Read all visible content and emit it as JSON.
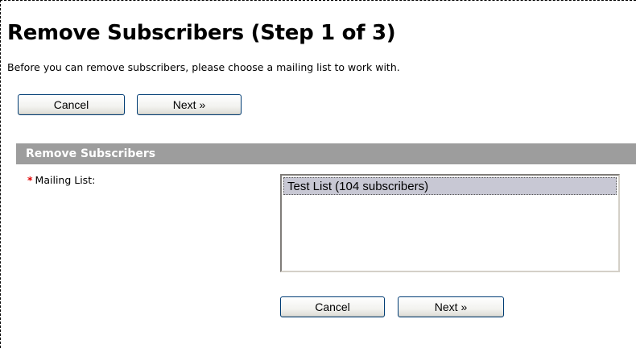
{
  "page": {
    "title": "Remove Subscribers (Step 1 of 3)",
    "intro": "Before you can remove subscribers, please choose a mailing list to work with."
  },
  "top_buttons": {
    "cancel": "Cancel",
    "next": "Next »"
  },
  "panel": {
    "header": "Remove Subscribers",
    "required_marker": "*",
    "mailing_list_label": "Mailing List:",
    "mailing_list_options": [
      {
        "label": "Test List (104 subscribers)",
        "selected": true
      }
    ]
  },
  "bottom_buttons": {
    "cancel": "Cancel",
    "next": "Next »"
  },
  "colors": {
    "panel_header_bg": "#9d9d9d",
    "required_marker": "#e00000",
    "selected_option_bg": "#c8c8d4"
  }
}
